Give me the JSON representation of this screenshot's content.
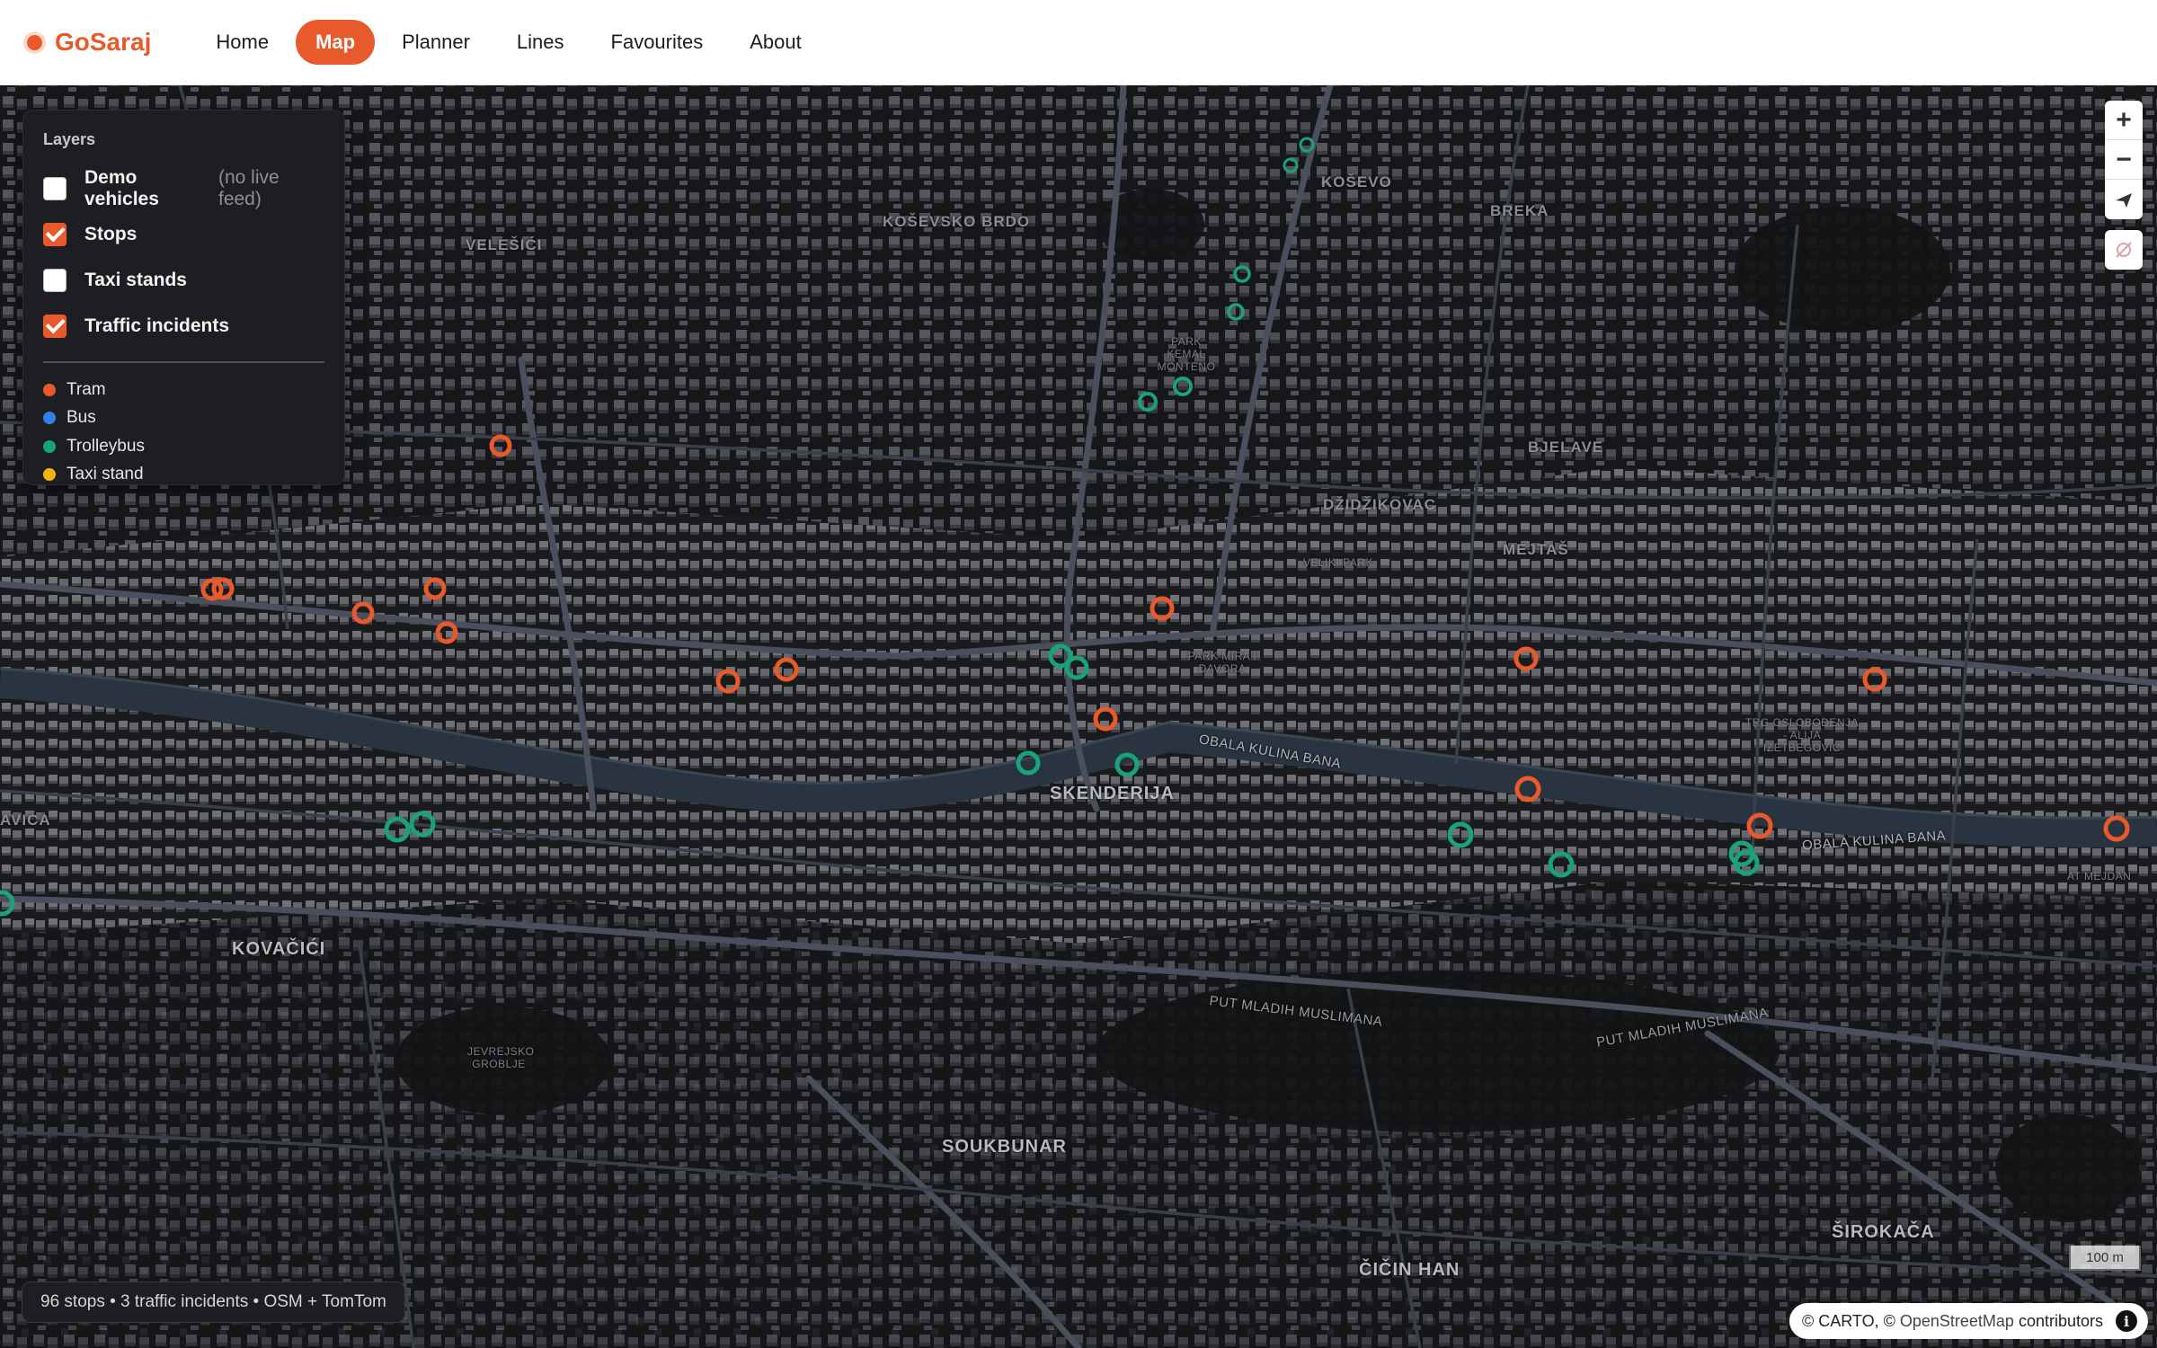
{
  "brand": {
    "name": "GoSaraj",
    "accent": "#e8592b"
  },
  "nav": [
    {
      "label": "Home",
      "active": false
    },
    {
      "label": "Map",
      "active": true
    },
    {
      "label": "Planner",
      "active": false
    },
    {
      "label": "Lines",
      "active": false
    },
    {
      "label": "Favourites",
      "active": false
    },
    {
      "label": "About",
      "active": false
    }
  ],
  "layers": {
    "title": "Layers",
    "items": [
      {
        "label": "Demo vehicles",
        "note": "(no live feed)",
        "checked": false
      },
      {
        "label": "Stops",
        "note": "",
        "checked": true
      },
      {
        "label": "Taxi stands",
        "note": "",
        "checked": false
      },
      {
        "label": "Traffic incidents",
        "note": "",
        "checked": true
      }
    ],
    "legend": [
      {
        "label": "Tram",
        "color": "#e8592b"
      },
      {
        "label": "Bus",
        "color": "#2f80ed"
      },
      {
        "label": "Trolleybus",
        "color": "#1aa37a"
      },
      {
        "label": "Taxi stand",
        "color": "#f2b705"
      }
    ]
  },
  "map_labels": {
    "skenderija": "SKENDERIJA",
    "kovacici": "KOVAČIĆI",
    "soukbunar": "SOUKBUNAR",
    "cicin_han": "ČIČIN HAN",
    "sirokaca": "ŠIROKAČA",
    "kosevo": "KOŠEVO",
    "kosevsko_brdo": "KOŠEVSKO BRDO",
    "velesici": "VELEŠIĆI",
    "breka": "BREKA",
    "bjelave": "BJELAVE",
    "dzidzikovac": "DŽIDŽIKOVAC",
    "mejtas": "MEJTAŠ",
    "jevrejsko_groblje": "JEVREJSKO GROBLJE",
    "at_mejdan": "AT MEJDAN",
    "put_mladih_1": "Put Mladih Muslimana",
    "put_mladih_2": "Put Mladih Muslimana",
    "obala": "Obala Kulina bana",
    "obala2": "Obala Kulina bana",
    "velki_park": "VELIKI PARK",
    "park_kemal": "PARK KEMAL MONTENO",
    "trg": "TRG OSLOBOĐENJA - ALIJA IZETBEGOVIĆ",
    "park_mir": "PARK MIRA I DAVORA",
    "avica": "AVICA"
  },
  "status_text": "96 stops • 3 traffic incidents • OSM + TomTom",
  "scale_label": "100 m",
  "attribution": {
    "prefix": "© CARTO, ©",
    "osm": "OpenStreetMap",
    "suffix": "contributors"
  },
  "controls": {
    "zoom_in": "+",
    "zoom_out": "−"
  },
  "icons": {
    "compass": "compass-icon",
    "info": "info-icon"
  }
}
